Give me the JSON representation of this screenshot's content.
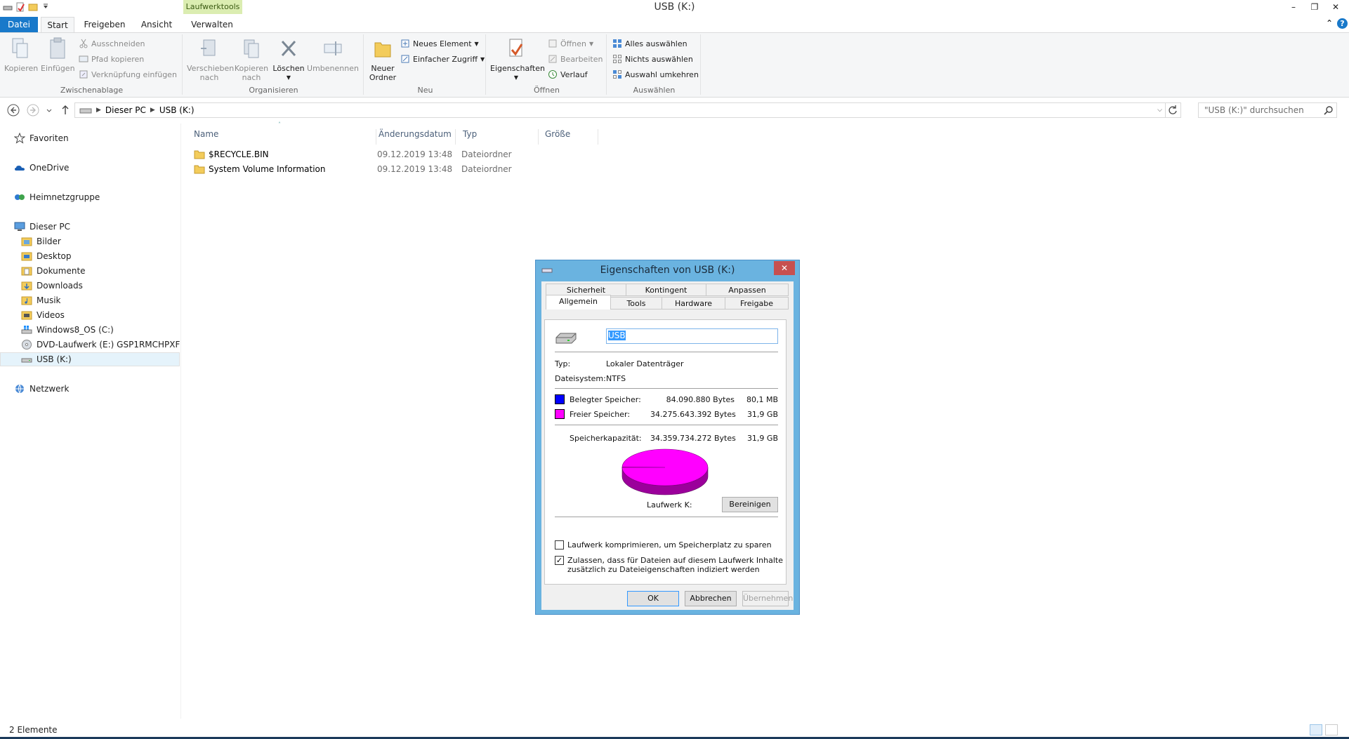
{
  "window": {
    "title": "USB (K:)",
    "context_tab_group": "Laufwerktools"
  },
  "ribbon_tabs": [
    "Datei",
    "Start",
    "Freigeben",
    "Ansicht",
    "Verwalten"
  ],
  "ribbon": {
    "zwischenablage": {
      "label": "Zwischenablage",
      "kopieren": "Kopieren",
      "einfuegen": "Einfügen",
      "ausschneiden": "Ausschneiden",
      "pfad_kopieren": "Pfad kopieren",
      "verknuepfung_einfuegen": "Verknüpfung einfügen"
    },
    "organisieren": {
      "label": "Organisieren",
      "verschieben_l1": "Verschieben",
      "verschieben_l2": "nach",
      "kopieren_l1": "Kopieren",
      "kopieren_l2": "nach",
      "loeschen": "Löschen",
      "umbenennen": "Umbenennen"
    },
    "neu": {
      "label": "Neu",
      "neuer_ordner_l1": "Neuer",
      "neuer_ordner_l2": "Ordner",
      "neues_element": "Neues Element",
      "einfacher_zugriff": "Einfacher Zugriff"
    },
    "oeffnen": {
      "label": "Öffnen",
      "eigenschaften": "Eigenschaften",
      "oeffnen": "Öffnen",
      "bearbeiten": "Bearbeiten",
      "verlauf": "Verlauf"
    },
    "auswaehlen": {
      "label": "Auswählen",
      "alles": "Alles auswählen",
      "nichts": "Nichts auswählen",
      "umkehren": "Auswahl umkehren"
    }
  },
  "address": {
    "crumbs": [
      "Dieser PC",
      "USB (K:)"
    ],
    "search_placeholder": "\"USB (K:)\" durchsuchen"
  },
  "nav": {
    "favoriten": "Favoriten",
    "onedrive": "OneDrive",
    "heimnetz": "Heimnetzgruppe",
    "dieser_pc": "Dieser PC",
    "pc_items": [
      "Bilder",
      "Desktop",
      "Dokumente",
      "Downloads",
      "Musik",
      "Videos",
      "Windows8_OS (C:)",
      "DVD-Laufwerk (E:) GSP1RMCHPXFRER_",
      "USB (K:)"
    ],
    "netzwerk": "Netzwerk"
  },
  "files": {
    "columns": [
      "Name",
      "Änderungsdatum",
      "Typ",
      "Größe"
    ],
    "rows": [
      {
        "name": "$RECYCLE.BIN",
        "date": "09.12.2019 13:48",
        "type": "Dateiordner"
      },
      {
        "name": "System Volume Information",
        "date": "09.12.2019 13:48",
        "type": "Dateiordner"
      }
    ]
  },
  "status": {
    "count": "2 Elemente"
  },
  "dialog": {
    "title": "Eigenschaften von USB (K:)",
    "tabs_back": [
      "Sicherheit",
      "Kontingent",
      "Anpassen"
    ],
    "tabs_front": [
      "Allgemein",
      "Tools",
      "Hardware",
      "Freigabe"
    ],
    "name_value": "USB",
    "typ_label": "Typ:",
    "typ_value": "Lokaler Datenträger",
    "fs_label": "Dateisystem:",
    "fs_value": "NTFS",
    "used_label": "Belegter Speicher:",
    "used_bytes": "84.090.880 Bytes",
    "used_size": "80,1 MB",
    "free_label": "Freier Speicher:",
    "free_bytes": "34.275.643.392 Bytes",
    "free_size": "31,9 GB",
    "cap_label": "Speicherkapazität:",
    "cap_bytes": "34.359.734.272 Bytes",
    "cap_size": "31,9 GB",
    "drive_label": "Laufwerk K:",
    "cleanup_button": "Bereinigen",
    "compress_label": "Laufwerk komprimieren, um Speicherplatz zu sparen",
    "compress_checked": false,
    "index_label_l1": "Zulassen, dass für Dateien auf diesem Laufwerk Inhalte",
    "index_label_l2": "zusätzlich zu Dateieigenschaften indiziert werden",
    "index_checked": true,
    "ok": "OK",
    "cancel": "Abbrechen",
    "apply": "Übernehmen",
    "used_color": "#0000ff",
    "free_color": "#ff00ff",
    "used_fraction": 0.00245
  }
}
